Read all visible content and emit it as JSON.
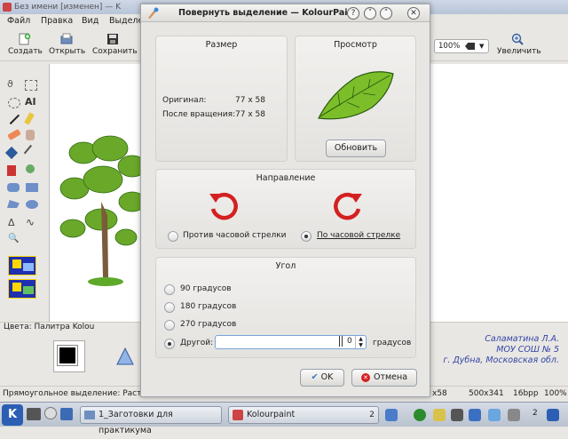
{
  "background_window": {
    "title": "Без имени [изменен] — K",
    "menu": [
      "Файл",
      "Правка",
      "Вид",
      "Выделе"
    ],
    "toolbar": {
      "create": "Создать",
      "open": "Открыть",
      "save": "Сохранить",
      "zoom_value": "100%",
      "zoom_in": "Увеличить"
    },
    "colorbar_label": "Цвета: Палитра Kolou",
    "status": {
      "left": "Прямоугольное выделение: Раст",
      "size_partial": "x58",
      "canvas_size": "500x341",
      "bpp": "16bpp",
      "zoom": "100%"
    },
    "watermark": [
      "Саламатина Л.А.",
      "МОУ СОШ № 5",
      "г. Дубна, Московская обл."
    ]
  },
  "taskbar": {
    "tasks": [
      {
        "label": "1_Заготовки для практикума",
        "count": ""
      },
      {
        "label": "Kolourpaint",
        "count": "2"
      }
    ],
    "clock": "2"
  },
  "dialog": {
    "title": "Повернуть выделение — KolourPaint",
    "size_panel": {
      "title": "Размер",
      "original_label": "Оригинал:",
      "original_value": "77 x 58",
      "after_label": "После вращения:",
      "after_value": "77 x 58"
    },
    "preview_panel": {
      "title": "Просмотр",
      "refresh_button": "Обновить"
    },
    "direction_panel": {
      "title": "Направление",
      "ccw_label": "Против часовой стрелки",
      "cw_label": "По часовой стрелке",
      "selected": "cw"
    },
    "angle_panel": {
      "title": "Угол",
      "options": [
        "90 градусов",
        "180 градусов",
        "270 градусов"
      ],
      "other_label": "Другой:",
      "other_value": "0",
      "unit": "градусов",
      "selected": "other"
    },
    "ok_button": "OK",
    "cancel_button": "Отмена"
  },
  "colors": {
    "accent_red": "#d42020",
    "watermark_blue": "#3345a8",
    "leaf_green": "#7cbe2a"
  }
}
